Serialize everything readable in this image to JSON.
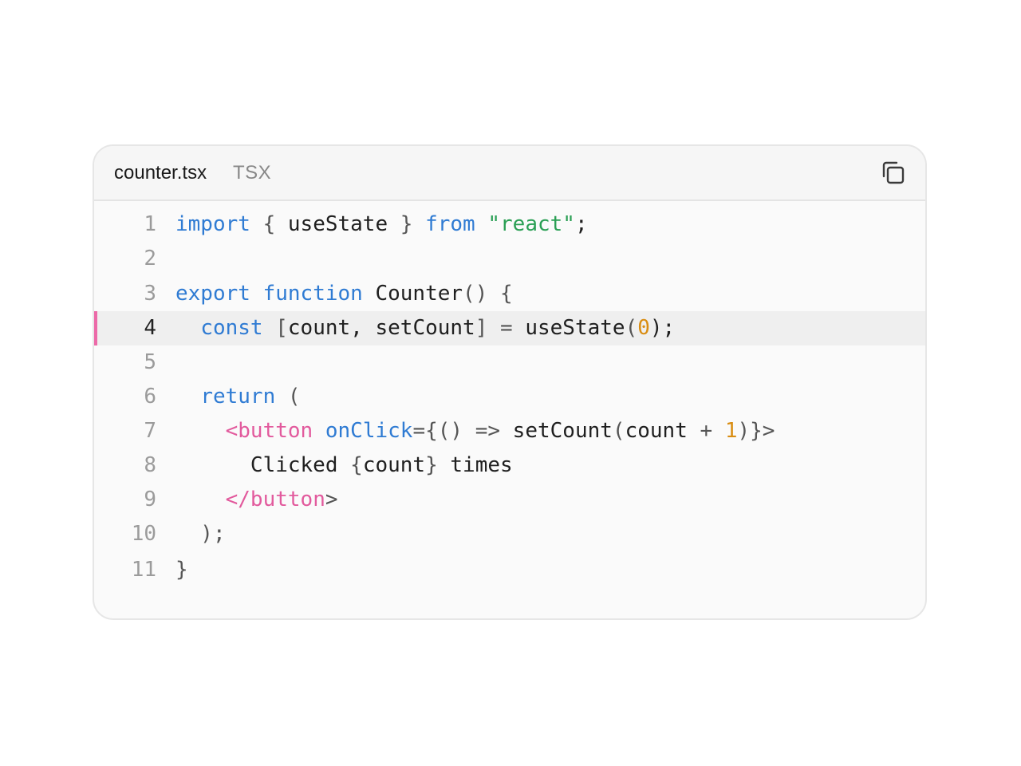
{
  "file": {
    "name": "counter.tsx",
    "language": "TSX"
  },
  "copy_button": {
    "icon": "copy-icon"
  },
  "highlighted_line": 4,
  "colors": {
    "keyword": "#2f7bd3",
    "string": "#2a9f54",
    "number": "#d98d12",
    "jsx_tag": "#e25a9d",
    "highlight_marker": "#ec6aa8"
  },
  "code_lines": [
    {
      "num": "1",
      "tokens": [
        {
          "t": "import",
          "c": "kw"
        },
        {
          "t": " ",
          "c": ""
        },
        {
          "t": "{",
          "c": "pn"
        },
        {
          "t": " useState ",
          "c": ""
        },
        {
          "t": "}",
          "c": "pn"
        },
        {
          "t": " ",
          "c": ""
        },
        {
          "t": "from",
          "c": "kw"
        },
        {
          "t": " ",
          "c": ""
        },
        {
          "t": "\"react\"",
          "c": "str"
        },
        {
          "t": ";",
          "c": ""
        }
      ]
    },
    {
      "num": "2",
      "tokens": []
    },
    {
      "num": "3",
      "tokens": [
        {
          "t": "export",
          "c": "kw"
        },
        {
          "t": " ",
          "c": ""
        },
        {
          "t": "function",
          "c": "kw"
        },
        {
          "t": " Counter",
          "c": ""
        },
        {
          "t": "()",
          "c": "pn"
        },
        {
          "t": " ",
          "c": ""
        },
        {
          "t": "{",
          "c": "pn"
        }
      ]
    },
    {
      "num": "4",
      "tokens": [
        {
          "t": "  ",
          "c": ""
        },
        {
          "t": "const",
          "c": "kw"
        },
        {
          "t": " ",
          "c": ""
        },
        {
          "t": "[",
          "c": "pn"
        },
        {
          "t": "count, setCount",
          "c": ""
        },
        {
          "t": "]",
          "c": "pn"
        },
        {
          "t": " ",
          "c": ""
        },
        {
          "t": "=",
          "c": "pn"
        },
        {
          "t": " useState",
          "c": ""
        },
        {
          "t": "(",
          "c": "pn"
        },
        {
          "t": "0",
          "c": "num"
        },
        {
          "t": ");",
          "c": ""
        }
      ]
    },
    {
      "num": "5",
      "tokens": []
    },
    {
      "num": "6",
      "tokens": [
        {
          "t": "  ",
          "c": ""
        },
        {
          "t": "return",
          "c": "kw"
        },
        {
          "t": " (",
          "c": "pn"
        }
      ]
    },
    {
      "num": "7",
      "tokens": [
        {
          "t": "    ",
          "c": ""
        },
        {
          "t": "<button",
          "c": "tag"
        },
        {
          "t": " ",
          "c": ""
        },
        {
          "t": "onClick",
          "c": "attr"
        },
        {
          "t": "={",
          "c": "pn"
        },
        {
          "t": "()",
          "c": "pn"
        },
        {
          "t": " ",
          "c": ""
        },
        {
          "t": "=>",
          "c": "pn"
        },
        {
          "t": " setCount",
          "c": ""
        },
        {
          "t": "(",
          "c": "pn"
        },
        {
          "t": "count ",
          "c": ""
        },
        {
          "t": "+",
          "c": "pn"
        },
        {
          "t": " ",
          "c": ""
        },
        {
          "t": "1",
          "c": "num"
        },
        {
          "t": ")}>",
          "c": "pn"
        }
      ]
    },
    {
      "num": "8",
      "tokens": [
        {
          "t": "      Clicked ",
          "c": ""
        },
        {
          "t": "{",
          "c": "pn"
        },
        {
          "t": "count",
          "c": ""
        },
        {
          "t": "}",
          "c": "pn"
        },
        {
          "t": " times",
          "c": ""
        }
      ]
    },
    {
      "num": "9",
      "tokens": [
        {
          "t": "    ",
          "c": ""
        },
        {
          "t": "</button",
          "c": "tag"
        },
        {
          "t": ">",
          "c": "pn"
        }
      ]
    },
    {
      "num": "10",
      "tokens": [
        {
          "t": "  );",
          "c": "pn"
        }
      ]
    },
    {
      "num": "11",
      "tokens": [
        {
          "t": "}",
          "c": "pn"
        }
      ]
    }
  ]
}
